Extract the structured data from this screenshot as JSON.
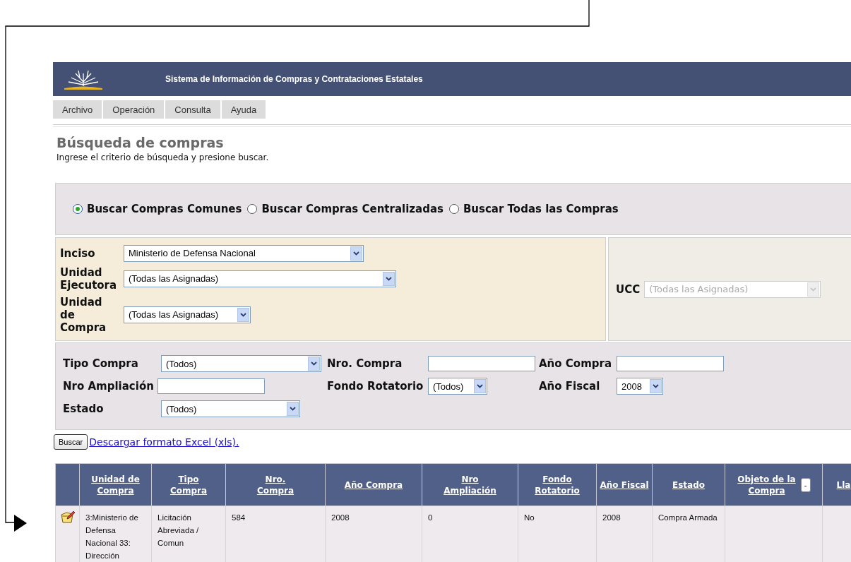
{
  "header": {
    "title": "Sistema de Información de Compras y Contrataciones Estatales"
  },
  "menu": [
    {
      "label": "Archivo"
    },
    {
      "label": "Operación"
    },
    {
      "label": "Consulta"
    },
    {
      "label": "Ayuda"
    }
  ],
  "page": {
    "title": "Búsqueda de compras",
    "subtitle": "Ingrese el criterio de búsqueda y presione buscar."
  },
  "search_modes": [
    {
      "label": "Buscar Compras Comunes",
      "selected": true
    },
    {
      "label": "Buscar Compras Centralizadas",
      "selected": false
    },
    {
      "label": "Buscar Todas las Compras",
      "selected": false
    }
  ],
  "unit_filters": [
    {
      "label": "Inciso",
      "kind": "select",
      "value": "Ministerio de Defensa Nacional"
    },
    {
      "label": "Unidad Ejecutora",
      "kind": "select",
      "value": "(Todas las Asignadas)"
    },
    {
      "label": "Unidad de Compra",
      "kind": "select",
      "value": "(Todas las Asignadas)"
    }
  ],
  "ucc": {
    "label": "UCC",
    "value": "(Todas las Asignadas)",
    "disabled": true
  },
  "filters": [
    {
      "label": "Tipo Compra",
      "kind": "select",
      "value": "(Todos)"
    },
    {
      "label": "Nro. Compra",
      "kind": "input"
    },
    {
      "label": "Año Compra",
      "kind": "input"
    },
    {
      "label": "Nro Ampliación",
      "kind": "input"
    },
    {
      "label": "Fondo Rotatorio",
      "kind": "select",
      "value": "(Todos)"
    },
    {
      "label": "Año Fiscal",
      "kind": "select",
      "value": "2008"
    },
    {
      "label": "Estado",
      "kind": "select",
      "value": "(Todos)"
    }
  ],
  "search_button": "Buscar",
  "excel_link": "Descargar formato Excel (xls).",
  "table": {
    "columns": [
      {
        "label": "Unidad de Compra"
      },
      {
        "label": "Tipo Compra"
      },
      {
        "label": "Nro. Compra"
      },
      {
        "label": "Año Compra"
      },
      {
        "label": "Nro Ampliación"
      },
      {
        "label": "Fondo Rotatorio"
      },
      {
        "label": "Año Fiscal"
      },
      {
        "label": "Estado"
      },
      {
        "label": "Objeto de la Compra",
        "toggle": "-"
      },
      {
        "label": "Lla"
      }
    ],
    "rows": [
      {
        "cells": [
          "3:Ministerio de Defensa Nacional 33: Dirección",
          "Licitación Abreviada / Comun",
          "584",
          "2008",
          "0",
          "No",
          "2008",
          "Compra Armada",
          "",
          ""
        ]
      }
    ]
  }
}
